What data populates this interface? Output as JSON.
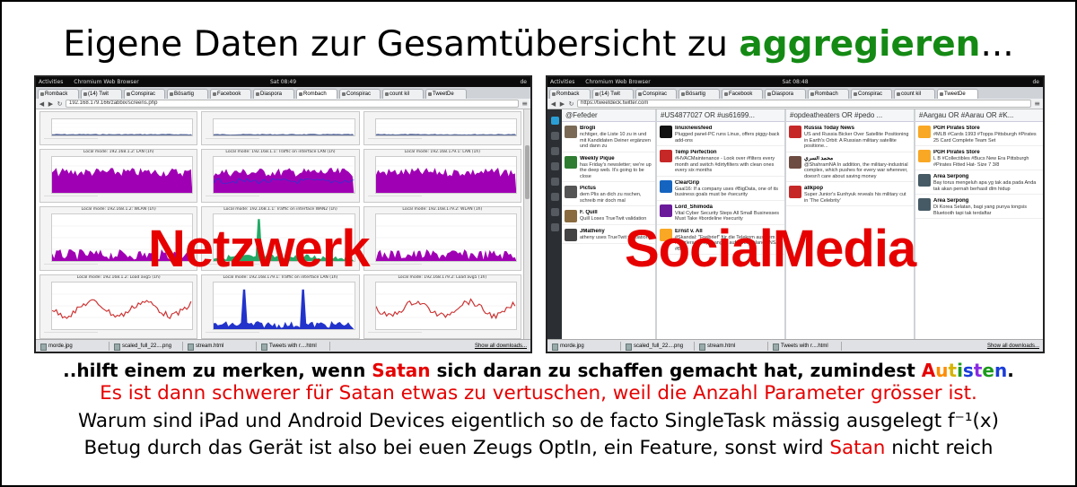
{
  "headline": {
    "prefix": "Eigene Daten zur Gesamtübersicht zu ",
    "highlight": "aggregieren",
    "suffix": "..."
  },
  "accent_colors": {
    "headline_green": "#148a14",
    "warning_red": "#e60000"
  },
  "left_screenshot": {
    "overlay_label": "Netzwerk",
    "topbar": {
      "activities": "Activities",
      "app": "Chromium Web Browser",
      "clock": "Sat 08:49",
      "lang": "de"
    },
    "tabs": [
      "Romback",
      "(14) Twit",
      "Conspirac",
      "Bösartig",
      "Facebook",
      "Diaspora",
      "Rombach",
      "Conspirac",
      "count kil",
      "TweetDe"
    ],
    "url": "192.168.179.166/zabbix/screens.php",
    "graph_titles": [
      "Local mode: 192.168.1.2: LAN (1h)",
      "Local mode: 192.168.1.1: Traffic on interface LAN (1h)",
      "Local mode: 192.168.179.1: LAN (1h)",
      "Local mode: 192.168.1.2: WLAN (1h)",
      "Local mode: 192.168.1.1: Traffic on interface WAN2 (1h)",
      "Local mode: 192.168.179.2: WLAN (1h)",
      "Local mode: 192.168.1.2: Load avg5 (1h)",
      "Local mode: 192.168.179.1: Traffic on interface LAN (1h)",
      "Local mode: 192.168.179.2: Load avg5 (1h)"
    ],
    "downloads": [
      "morde.jpg",
      "scaled_full_22....png",
      "stream.html",
      "Tweets with r....html"
    ],
    "show_all": "Show all downloads..."
  },
  "right_screenshot": {
    "overlay_label": "SocialMedia",
    "topbar": {
      "activities": "Activities",
      "app": "Chromium Web Browser",
      "clock": "Sat 08:48",
      "lang": "de"
    },
    "tabs": [
      "Romback",
      "(14) Twit",
      "Conspirac",
      "Bösartig",
      "Facebook",
      "Diaspora",
      "Rombach",
      "Conspirac",
      "count kil",
      "TweetDe"
    ],
    "url": "https://tweetdeck.twitter.com",
    "columns": [
      {
        "header": "@Fefeder",
        "tweets": [
          {
            "name": "Brogli",
            "text": "nchtiger, die Liste 10 zu in und mit Kandidaten Deiner ergänzen und dann zu",
            "color": "#7a6a55"
          },
          {
            "name": "Weekly Pique",
            "text": "has Friday's newsletter; we're up the deep web. It's going to be close",
            "color": "#2e7d32"
          },
          {
            "name": "Pictus",
            "text": "dem Plis an dich zu nschen, schreib mir doch mal",
            "color": "#555"
          },
          {
            "name": "F. Quill",
            "text": "Quill Loses TrueTwit validation",
            "color": "#8a6b3f"
          },
          {
            "name": "JMatheny",
            "text": "atheny uses TrueTwit validation",
            "color": "#444"
          }
        ]
      },
      {
        "header": "#US4877027 OR #us61699...",
        "tweets": [
          {
            "name": "linuxnewsfeed",
            "text": "Plugged panel-PC runs Linux, offers piggy-back add-ons",
            "color": "#111"
          },
          {
            "name": "Temp Perfection",
            "text": "#HVACMaintenance - Look over #filters every month and switch #dirtyfilters with clean ones every six months",
            "color": "#c62828"
          },
          {
            "name": "ClearGrip",
            "text": "Gaal16: If a company uses #BigData, one of its business goals must be #security",
            "color": "#1565c0"
          },
          {
            "name": "Lord_Shimoda",
            "text": "Vital Cyber Security Steps All Small Businesses Must Take #bordeline #security",
            "color": "#6a1b9a"
          },
          {
            "name": "Ernst v. All",
            "text": "#Skandal: \"Freibrief\" für die Telekom aus dem Kanzleramt: Spähangriff auf Deutschland #NSA #BND",
            "color": "#f9a825"
          }
        ]
      },
      {
        "header": "#opdeatheaters OR #pedo ...",
        "tweets": [
          {
            "name": "Russia Today News",
            "text": "US and Russia Bicker Over Satellite Positioning in Earth's Orbit: A Russian military satellite positione...",
            "color": "#c62828"
          },
          {
            "name": "محمد السري",
            "text": "@ShahramNA In addition, the military-industrial complex, which pushes for every war wherever, doesn't care about saving money",
            "color": "#6d4c41"
          },
          {
            "name": "allkpop",
            "text": "Super Junior's Eunhyuk reveals his military cut in 'The Celebrity'",
            "color": "#c62828"
          }
        ]
      },
      {
        "header": "#Aargau OR #Aarau OR #K...",
        "tweets": [
          {
            "name": "PGH Pirates Store",
            "text": "#MLB #Cards 1993 #Topps Pittsburgh #Pirates 25 Card Complete Team Set",
            "color": "#f9a825"
          },
          {
            "name": "PGH Pirates Store",
            "text": "L B #Collectibles #Bucs New Era Pittsburgh #Pirates Fitted Hat- Size 7 3/8",
            "color": "#f9a825"
          },
          {
            "name": "Area Serpong",
            "text": "Bay torus mengeluh apa yg tak ada pada Anda tak akan pernah berhasil dlm hidup",
            "color": "#455a64"
          },
          {
            "name": "Area Serpong",
            "text": "Di Korea Selatan, bagi yang punya tongsis Bluetooth tapi tak terdaftar",
            "color": "#455a64"
          }
        ]
      }
    ],
    "downloads": [
      "morde.jpg",
      "scaled_full_22....png",
      "stream.html",
      "Tweets with r....html"
    ],
    "show_all": "Show all downloads..."
  },
  "lines": {
    "line1": {
      "a": "..hilft einem zu merken, wenn ",
      "satan": "Satan",
      "b": " sich daran zu schaffen gemacht hat, zumindest ",
      "autisten": [
        "A",
        "u",
        "t",
        "i",
        "s",
        "t",
        "e",
        "n"
      ],
      "end": "."
    },
    "line2": "Es ist dann schwerer für Satan etwas zu vertuschen, weil die Anzahl Parameter grösser ist.",
    "line3": "Warum sind iPad und Android Devices eigentlich so de facto SingleTask mässig ausgelegt f⁻¹(x)",
    "line4": {
      "a": "Betug durch das Gerät ist also bei euen Zeugs OptIn, ein Feature, sonst wird ",
      "satan": "Satan",
      "b": " nicht reich"
    }
  }
}
